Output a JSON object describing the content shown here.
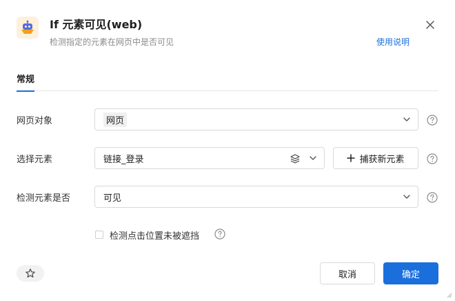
{
  "header": {
    "title": "If 元素可见(web)",
    "subtitle": "检测指定的元素在网页中是否可见",
    "help_link": "使用说明",
    "icon": "robot-icon",
    "close_icon": "close-icon"
  },
  "tabs": [
    {
      "label": "常规",
      "active": true
    }
  ],
  "form": {
    "webpage": {
      "label": "网页对象",
      "value": "网页"
    },
    "element": {
      "label": "选择元素",
      "value": "链接_登录",
      "capture_label": "捕获新元素"
    },
    "detect": {
      "label": "检测元素是否",
      "value": "可见"
    },
    "checkbox": {
      "label": "检测点击位置未被遮挡",
      "checked": false
    }
  },
  "footer": {
    "cancel_label": "取消",
    "ok_label": "确定",
    "star_icon": "star-icon"
  },
  "colors": {
    "accent": "#1a6fdc",
    "icon_bg": "#fdf1dc",
    "icon_orange": "#f0a020"
  }
}
